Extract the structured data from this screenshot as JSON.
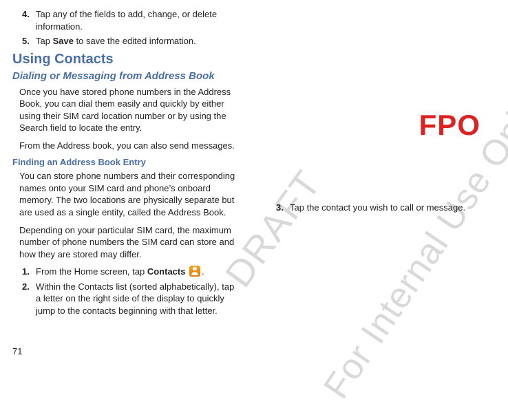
{
  "left": {
    "step4": {
      "n": "4.",
      "t_a": "Tap any of the fields to add, change, or delete information."
    },
    "step5": {
      "n": "5.",
      "t_a": "Tap ",
      "t_bold": "Save",
      "t_b": " to save the edited information."
    },
    "h2": "Using Contacts",
    "h3": "Dialing or Messaging from Address Book",
    "p1": "Once you have stored phone numbers in the Address Book, you can dial them easily and quickly by either using their SIM card location number or by using the Search field to locate the entry.",
    "p2": "From the Address book, you can also send messages.",
    "h4": "Finding an Address Book Entry",
    "p3": "You can store phone numbers and their corresponding names onto your SIM card and phone’s onboard memory. The two locations are physically separate but are used as a single entity, called the Address Book.",
    "p4": "Depending on your particular SIM card, the maximum number of phone numbers the SIM card can store and how they are stored may differ.",
    "step1": {
      "n": "1.",
      "t_a": "From the Home screen, tap ",
      "t_bold": "Contacts",
      "t_b": " ",
      "t_c": "."
    },
    "step2": {
      "n": "2.",
      "t_a": "Within the Contacts list (sorted alphabetically), tap a letter on the right side of the display to quickly jump to the contacts beginning with that letter."
    }
  },
  "right": {
    "fpo": "FPO",
    "step3": {
      "n": "3.",
      "t": "Tap the contact you wish to call or message."
    }
  },
  "watermark1": "DRAFT",
  "watermark2": "For Internal Use Only",
  "page_number": "71"
}
